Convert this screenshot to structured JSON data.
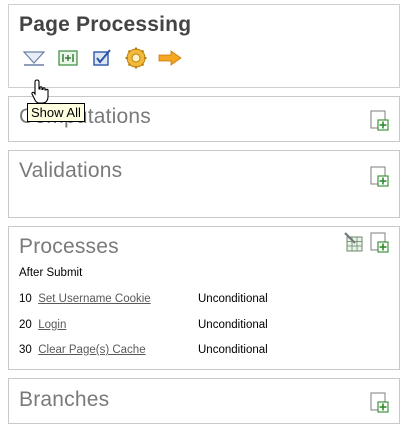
{
  "main": {
    "title": "Page Processing"
  },
  "toolbar": {
    "items": [
      {
        "icon": "show-all-icon"
      },
      {
        "icon": "expand-icon"
      },
      {
        "icon": "check-icon"
      },
      {
        "icon": "gear-icon"
      },
      {
        "icon": "arrow-right-icon"
      }
    ]
  },
  "tooltip": {
    "text": "Show All"
  },
  "computations": {
    "title": "Computations"
  },
  "validations": {
    "title": "Validations"
  },
  "processes": {
    "title": "Processes",
    "point": "After Submit",
    "rows": [
      {
        "seq": "10",
        "name": "Set Username Cookie",
        "condition": "Unconditional"
      },
      {
        "seq": "20",
        "name": "Login",
        "condition": "Unconditional"
      },
      {
        "seq": "30",
        "name": "Clear Page(s) Cache",
        "condition": "Unconditional"
      }
    ]
  },
  "branches": {
    "title": "Branches"
  },
  "colors": {
    "accent_orange": "#f0a020",
    "icon_green": "#3a8a3a",
    "icon_blue": "#2c55a8",
    "text_gray": "#7a7a7a"
  }
}
